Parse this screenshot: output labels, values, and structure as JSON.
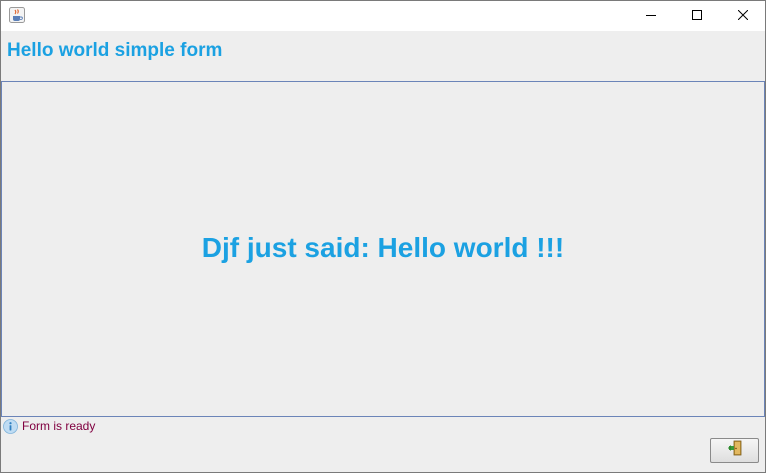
{
  "window": {
    "title": "",
    "app_icon": "java-cup-icon",
    "controls": [
      "minimize-icon",
      "maximize-icon",
      "close-icon"
    ]
  },
  "form": {
    "title": "Hello world simple form"
  },
  "main": {
    "message": "Djf just said: Hello world !!!"
  },
  "status": {
    "icon": "info-icon",
    "text": "Form is ready"
  },
  "footer": {
    "exit_icon": "exit-door-icon"
  },
  "colors": {
    "accent": "#1ba1e2",
    "status_text": "#800040",
    "content_border": "#6b84b8",
    "background": "#eeeeee"
  }
}
